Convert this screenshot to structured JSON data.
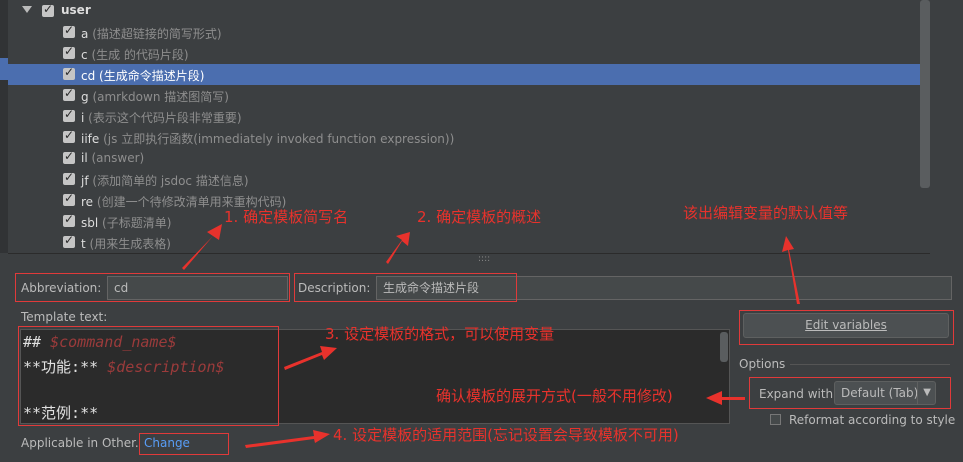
{
  "tree": {
    "group_label": "user",
    "items": [
      {
        "key": "a",
        "desc": "(描述超链接的简写形式)",
        "selected": false
      },
      {
        "key": "c",
        "desc": "(生成 的代码片段)",
        "selected": false
      },
      {
        "key": "cd",
        "desc": "(生成命令描述片段)",
        "selected": true
      },
      {
        "key": "g",
        "desc": "(amrkdown 描述图简写)",
        "selected": false
      },
      {
        "key": "i",
        "desc": "(表示这个代码片段非常重要)",
        "selected": false
      },
      {
        "key": "iife",
        "desc": "(js 立即执行函数(immediately invoked function expression))",
        "selected": false
      },
      {
        "key": "il",
        "desc": "(answer)",
        "selected": false
      },
      {
        "key": "jf",
        "desc": "(添加简单的 jsdoc 描述信息)",
        "selected": false
      },
      {
        "key": "re",
        "desc": "(创建一个待修改清单用来重构代码)",
        "selected": false
      },
      {
        "key": "sbl",
        "desc": "(子标题清单)",
        "selected": false
      },
      {
        "key": "t",
        "desc": "(用来生成表格)",
        "selected": false
      }
    ]
  },
  "splitter_glyph": "::::",
  "abbreviation": {
    "label": "Abbreviation:",
    "value": "cd"
  },
  "description": {
    "label": "Description:",
    "value": "生成命令描述片段"
  },
  "template": {
    "label": "Template text:",
    "line1_prefix": "## ",
    "line1_var": "$command_name$",
    "line2_prefix": "**功能:** ",
    "line2_var": "$description$",
    "line4": "**范例:**"
  },
  "edit_variables_label": "Edit variables",
  "options": {
    "label": "Options",
    "expand_label": "Expand with",
    "expand_value": "Default (Tab)",
    "reformat_label": "Reformat according to style"
  },
  "applicable": {
    "label": "Applicable in Other.",
    "link": "Change"
  },
  "annotations": {
    "a1": "1. 确定模板简写名",
    "a2": "2. 确定模板的概述",
    "a3": "该出编辑变量的默认值等",
    "a4": "3. 设定模板的格式，可以使用变量",
    "a5": "确认模板的展开方式(一般不用修改)",
    "a6": "4. 设定模板的适用范围(忘记设置会导致模板不可用)"
  },
  "colors": {
    "annotation": "#e8322c",
    "selection": "#4b6eaf",
    "link": "#589df6"
  }
}
